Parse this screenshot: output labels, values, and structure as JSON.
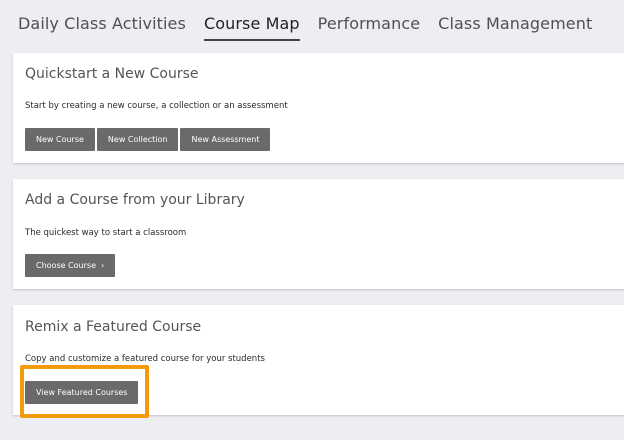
{
  "tabs": [
    {
      "label": "Daily Class Activities",
      "active": false
    },
    {
      "label": "Course Map",
      "active": true
    },
    {
      "label": "Performance",
      "active": false
    },
    {
      "label": "Class Management",
      "active": false
    }
  ],
  "quickstart": {
    "title": "Quickstart a New Course",
    "description": "Start by creating a new course, a collection or an assessment",
    "buttons": [
      "New Course",
      "New Collection",
      "New Assessment"
    ]
  },
  "library": {
    "title": "Add a Course from your Library",
    "description": "The quickest way to start a classroom",
    "button": "Choose Course",
    "button_icon": "chevron-right-icon"
  },
  "featured": {
    "title": "Remix a Featured Course",
    "description": "Copy and customize a featured course for your students",
    "button": "View Featured Courses"
  },
  "colors": {
    "button_bg": "#6a6a6a",
    "highlight": "#f59a0c",
    "background": "#eceef1"
  }
}
